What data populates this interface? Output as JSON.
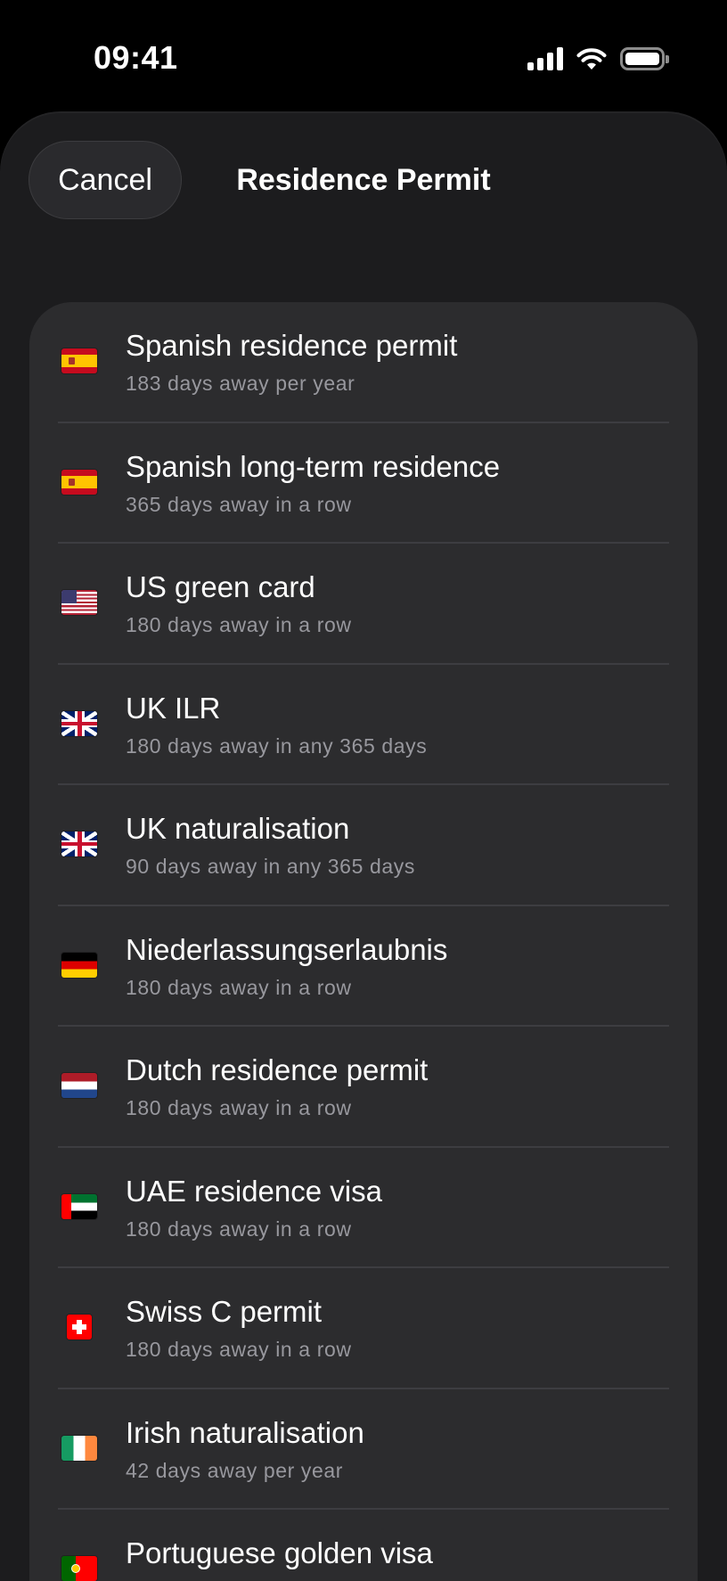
{
  "status_bar": {
    "time": "09:41",
    "icons": [
      "cellular-signal-icon",
      "wifi-icon",
      "battery-icon"
    ]
  },
  "header": {
    "cancel_label": "Cancel",
    "title": "Residence Permit"
  },
  "colors": {
    "background": "#000000",
    "sheet": "#1c1c1e",
    "card": "#2c2c2e",
    "secondary_text": "#98989e",
    "divider": "#3d3d41"
  },
  "permits": [
    {
      "flag": "flag-spain-icon",
      "title": "Spanish residence permit",
      "subtitle": "183 days away per year"
    },
    {
      "flag": "flag-spain-icon",
      "title": "Spanish long-term residence",
      "subtitle": "365 days away in a row"
    },
    {
      "flag": "flag-usa-icon",
      "title": "US green card",
      "subtitle": "180 days away in a row"
    },
    {
      "flag": "flag-uk-icon",
      "title": "UK ILR",
      "subtitle": "180 days away in any 365 days"
    },
    {
      "flag": "flag-uk-icon",
      "title": "UK naturalisation",
      "subtitle": "90 days away in any 365 days"
    },
    {
      "flag": "flag-germany-icon",
      "title": "Niederlassungserlaubnis",
      "subtitle": "180 days away in a row"
    },
    {
      "flag": "flag-netherlands-icon",
      "title": "Dutch residence permit",
      "subtitle": "180 days away in a row"
    },
    {
      "flag": "flag-uae-icon",
      "title": "UAE residence visa",
      "subtitle": "180 days away in a row"
    },
    {
      "flag": "flag-switzerland-icon",
      "title": "Swiss C permit",
      "subtitle": "180 days away in a row"
    },
    {
      "flag": "flag-ireland-icon",
      "title": "Irish naturalisation",
      "subtitle": "42 days away per year"
    },
    {
      "flag": "flag-portugal-icon",
      "title": "Portuguese golden visa",
      "subtitle": ""
    }
  ]
}
